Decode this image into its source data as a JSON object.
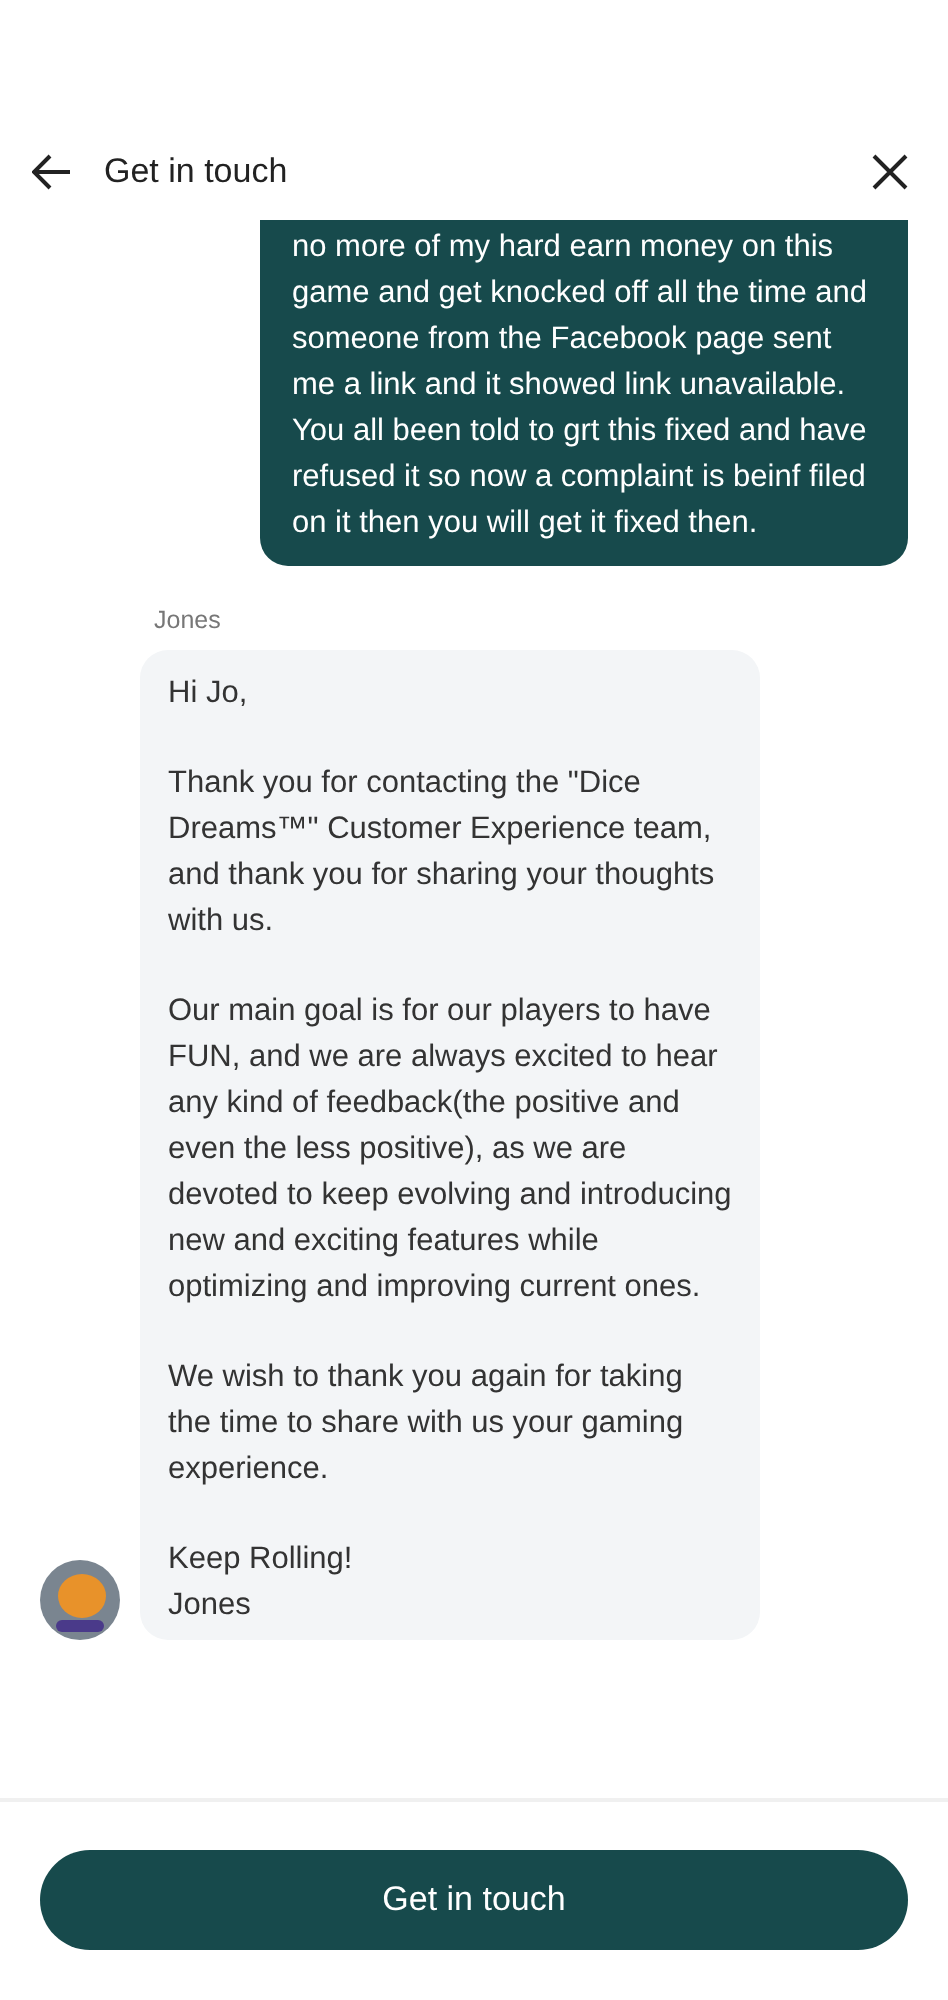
{
  "header": {
    "title": "Get in touch"
  },
  "messages": [
    {
      "kind": "sent",
      "text": "no more of my hard earn money on this game and get knocked off all the time and someone from the Facebook page sent me a link and it showed link unavailable. You all been told to grt this fixed and have refused it so now a complaint is beinf filed on it then you will get it fixed then."
    },
    {
      "kind": "received",
      "sender": "Jones",
      "paragraphs": [
        "Hi Jo,",
        "Thank you for contacting the \"Dice Dreams™\" Customer Experience team, and thank you for sharing your thoughts with us.",
        "Our main goal is for our players to have FUN, and we are always excited to hear any kind of feedback(the positive and even the less positive), as we are devoted to keep evolving and introducing new and exciting features while optimizing and improving current ones.",
        "We wish to thank you again for taking the time to share with us your gaming experience.",
        "Keep Rolling!\nJones"
      ]
    }
  ],
  "button": {
    "label": "Get in touch"
  }
}
